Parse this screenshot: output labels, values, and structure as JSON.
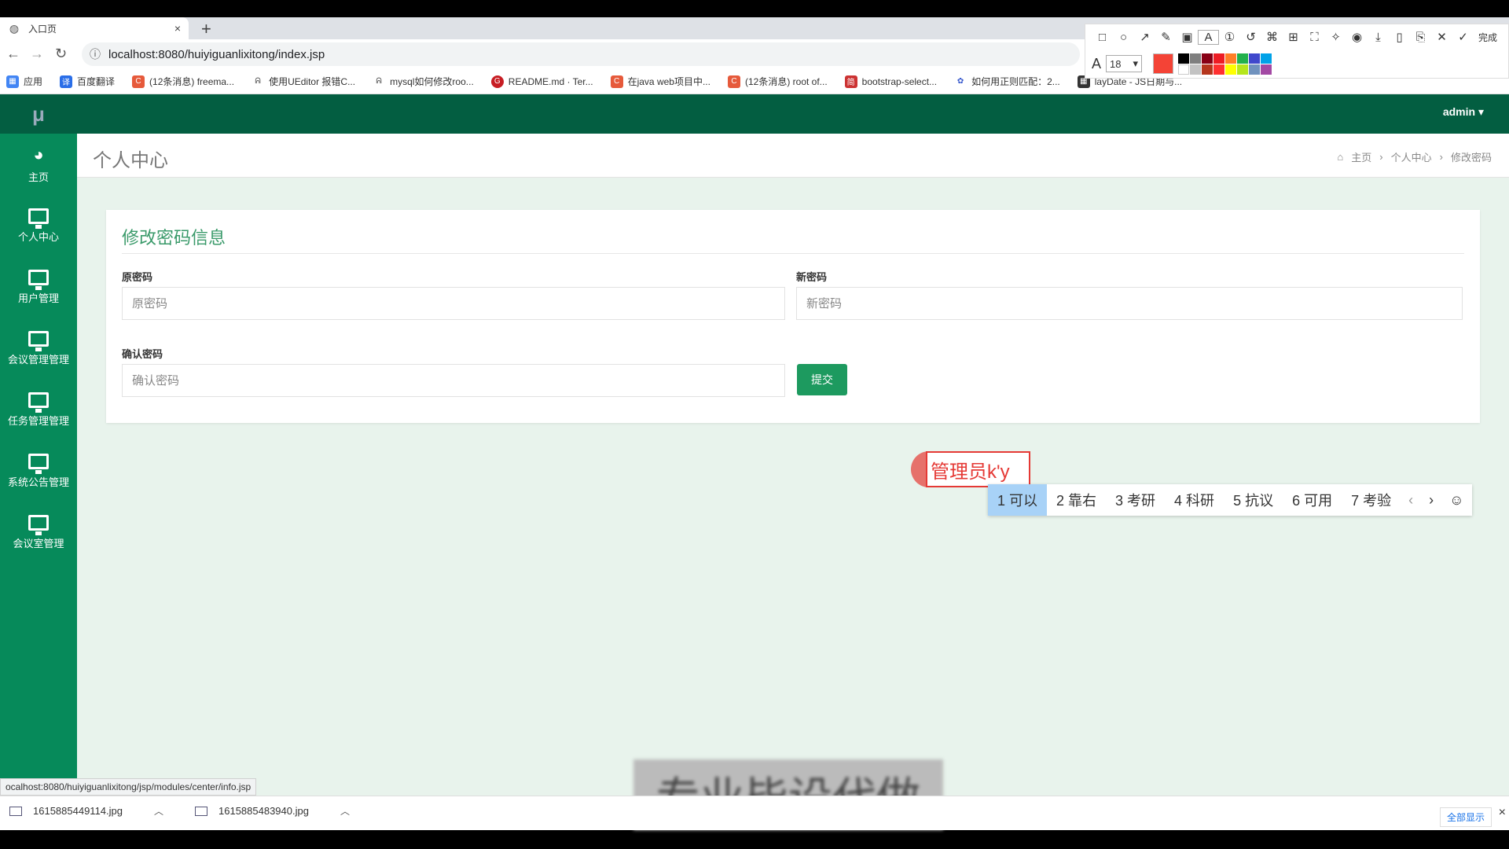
{
  "browser": {
    "tab_title": "入口页",
    "tab_close": "×",
    "new_tab": "+",
    "url": "localhost:8080/huiyiguanlixitong/index.jsp",
    "bookmarks": [
      {
        "label": "应用",
        "color": "#4285f4",
        "icon": "apps-icon"
      },
      {
        "label": "百度翻译",
        "color": "#2a6ee8",
        "icon": "译"
      },
      {
        "label": "(12条消息) freema...",
        "color": "#e65a3b",
        "icon": "C"
      },
      {
        "label": "使用UEditor 报错C...",
        "color": "#555",
        "icon": "ᕱ"
      },
      {
        "label": "mysql如何修改roo...",
        "color": "#555",
        "icon": "ᕱ"
      },
      {
        "label": "README.md · Ter...",
        "color": "#c71d23",
        "icon": "G"
      },
      {
        "label": "在java web项目中...",
        "color": "#e65a3b",
        "icon": "C"
      },
      {
        "label": "(12条消息) root of...",
        "color": "#e65a3b",
        "icon": "C"
      },
      {
        "label": "bootstrap-select...",
        "color": "#c33",
        "icon": "简"
      },
      {
        "label": "如何用正则匹配：2...",
        "color": "#3355cc",
        "icon": "✿"
      },
      {
        "label": "layDate - JS日期与...",
        "color": "#333",
        "icon": "▦"
      }
    ]
  },
  "shot_tool": {
    "done_label": "完成",
    "font_size": "18",
    "current_color": "#f44336",
    "swatches": [
      "#000000",
      "#7f7f7f",
      "#880015",
      "#ed1c24",
      "#ff7f27",
      "#22b14c",
      "#3f48cc",
      "#00a2e8",
      "#ffffff",
      "#c3c3c3",
      "#b5361d",
      "#ff3030",
      "#ffff00",
      "#b5e61d",
      "#7092be",
      "#a349a4"
    ]
  },
  "app": {
    "logo": "μ",
    "user_menu": "admin ▾",
    "sidebar": [
      {
        "label": "主页",
        "icon": "dashboard-icon"
      },
      {
        "label": "个人中心",
        "icon": "monitor-icon"
      },
      {
        "label": "用户管理",
        "icon": "monitor-icon"
      },
      {
        "label": "会议管理管理",
        "icon": "monitor-icon"
      },
      {
        "label": "任务管理管理",
        "icon": "monitor-icon"
      },
      {
        "label": "系统公告管理",
        "icon": "monitor-icon"
      },
      {
        "label": "会议室管理",
        "icon": "monitor-icon"
      }
    ],
    "page_title": "个人中心",
    "breadcrumb": [
      "主页",
      "个人中心",
      "修改密码"
    ],
    "form": {
      "title": "修改密码信息",
      "old_label": "原密码",
      "old_placeholder": "原密码",
      "new_label": "新密码",
      "new_placeholder": "新密码",
      "confirm_label": "确认密码",
      "confirm_placeholder": "确认密码",
      "submit": "提交"
    },
    "ime": {
      "composition": "管理员k'y",
      "candidates": [
        "1 可以",
        "2 靠右",
        "3 考研",
        "4 科研",
        "5 抗议",
        "6 可用",
        "7 考验"
      ],
      "prev": "‹",
      "next": "›",
      "emoji": "☺"
    },
    "blurred_text": "专业毕设代做"
  },
  "status": {
    "hover_url": "ocalhost:8080/huiyiguanlixitong/jsp/modules/center/info.jsp"
  },
  "downloads": {
    "items": [
      "1615885449114.jpg",
      "1615885483940.jpg"
    ],
    "show_all": "全部显示",
    "close": "×"
  }
}
